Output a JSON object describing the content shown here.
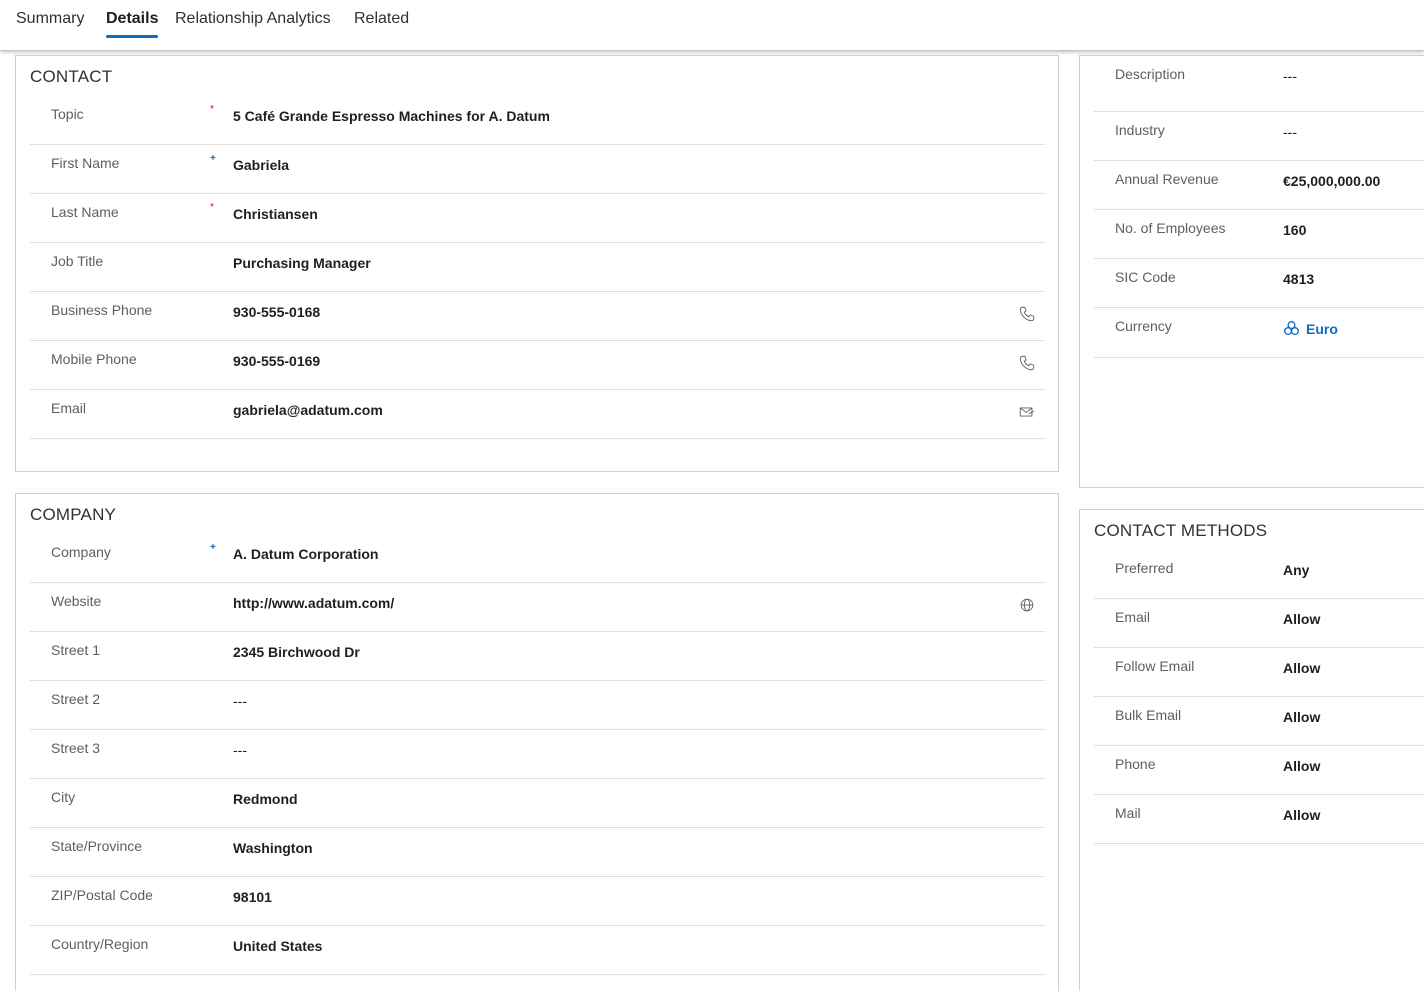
{
  "tabs": [
    {
      "label": "Summary"
    },
    {
      "label": "Details"
    },
    {
      "label": "Relationship Analytics"
    },
    {
      "label": "Related"
    }
  ],
  "active_tab": "Details",
  "contact": {
    "title": "CONTACT",
    "fields": {
      "topic": {
        "label": "Topic",
        "value": "5 Café Grande Espresso Machines for A. Datum",
        "required": "*"
      },
      "first_name": {
        "label": "First Name",
        "value": "Gabriela",
        "required": "+"
      },
      "last_name": {
        "label": "Last Name",
        "value": "Christiansen",
        "required": "*"
      },
      "job_title": {
        "label": "Job Title",
        "value": "Purchasing Manager"
      },
      "business_phone": {
        "label": "Business Phone",
        "value": "930-555-0168",
        "icon": "phone-icon"
      },
      "mobile_phone": {
        "label": "Mobile Phone",
        "value": "930-555-0169",
        "icon": "phone-icon"
      },
      "email": {
        "label": "Email",
        "value": "gabriela@adatum.com",
        "icon": "send-email-icon"
      }
    }
  },
  "company": {
    "title": "COMPANY",
    "fields": {
      "company": {
        "label": "Company",
        "value": "A. Datum Corporation",
        "required": "+"
      },
      "website": {
        "label": "Website",
        "value": "http://www.adatum.com/",
        "icon": "globe-icon"
      },
      "street1": {
        "label": "Street 1",
        "value": "2345 Birchwood Dr"
      },
      "street2": {
        "label": "Street 2",
        "value": "---"
      },
      "street3": {
        "label": "Street 3",
        "value": "---"
      },
      "city": {
        "label": "City",
        "value": "Redmond"
      },
      "state": {
        "label": "State/Province",
        "value": "Washington"
      },
      "zip": {
        "label": "ZIP/Postal Code",
        "value": "98101"
      },
      "country": {
        "label": "Country/Region",
        "value": "United States"
      }
    }
  },
  "company_details": {
    "fields": {
      "description": {
        "label": "Description",
        "value": "---"
      },
      "industry": {
        "label": "Industry",
        "value": "---"
      },
      "annual_revenue": {
        "label": "Annual Revenue",
        "value": "€25,000,000.00"
      },
      "employees": {
        "label": "No. of Employees",
        "value": "160"
      },
      "sic_code": {
        "label": "SIC Code",
        "value": "4813"
      },
      "currency": {
        "label": "Currency",
        "value": "Euro",
        "icon": "currency-entity-icon"
      }
    }
  },
  "contact_methods": {
    "title": "CONTACT METHODS",
    "fields": {
      "preferred": {
        "label": "Preferred",
        "value": "Any"
      },
      "email": {
        "label": "Email",
        "value": "Allow"
      },
      "follow_email": {
        "label": "Follow Email",
        "value": "Allow"
      },
      "bulk_email": {
        "label": "Bulk Email",
        "value": "Allow"
      },
      "phone": {
        "label": "Phone",
        "value": "Allow"
      },
      "mail": {
        "label": "Mail",
        "value": "Allow"
      }
    }
  },
  "colors": {
    "accent": "#0f6cbd",
    "required_red": "#c50f1f",
    "label_gray": "#605e5c",
    "divider": "#e1dfdd"
  }
}
